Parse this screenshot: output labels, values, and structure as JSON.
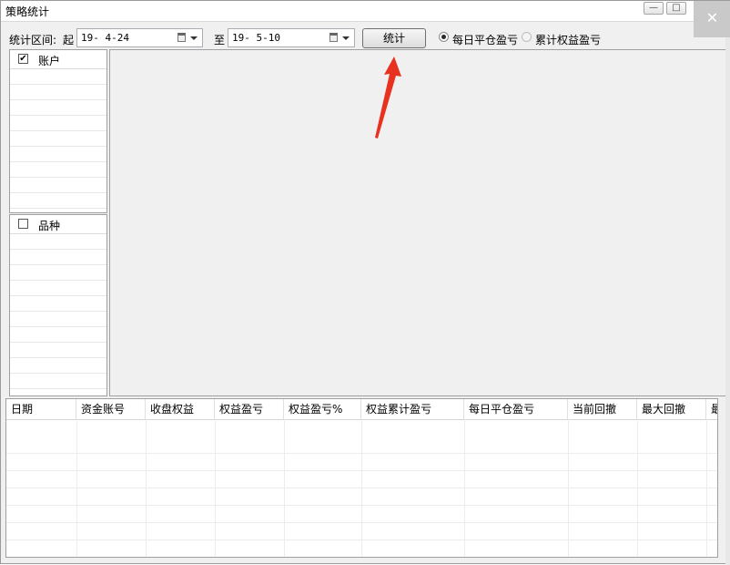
{
  "window": {
    "title": "策略统计",
    "minimize_icon": "minimize-icon",
    "maximize_icon": "maximize-icon",
    "close_icon": "close-icon"
  },
  "toolbar": {
    "range_label": "统计区间:",
    "from_label": "起",
    "from_date": "19- 4-24",
    "to_label": "至",
    "to_date": "19- 5-10",
    "stat_button": "统计",
    "radio_daily": "每日平仓盈亏",
    "radio_cumulative": "累计权益盈亏",
    "selected_radio": "每日平仓盈亏"
  },
  "account_panel": {
    "title": "账户",
    "checked": true
  },
  "variety_panel": {
    "title": "品种",
    "checked": false
  },
  "table": {
    "columns": [
      "日期",
      "资金账号",
      "收盘权益",
      "权益盈亏",
      "权益盈亏%",
      "权益累计盈亏",
      "每日平仓盈亏",
      "当前回撤",
      "最大回撤",
      "最"
    ],
    "rows": []
  },
  "annotation": {
    "arrow_color": "#e8321f"
  }
}
